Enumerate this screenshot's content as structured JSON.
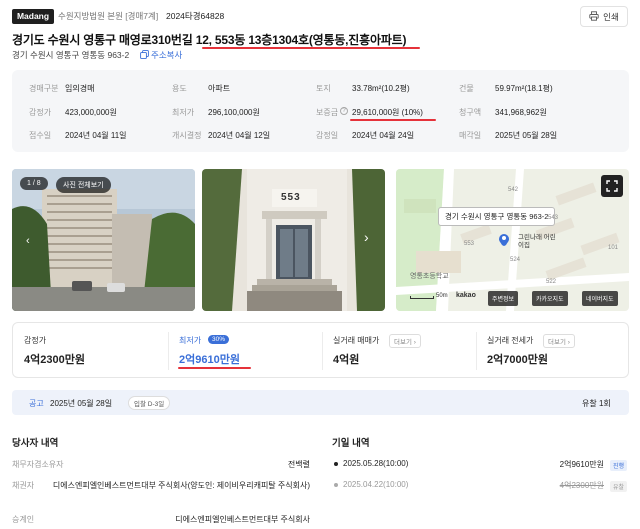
{
  "header": {
    "logo": "Madang",
    "court": "수원지방법원 본원 [경매7계]",
    "case_no": "2024타경64828",
    "print_label": "인쇄"
  },
  "title": {
    "address": "경기도 수원시 영통구 매영로310번길 12, 553동 13층1304호(영통동,진흥아파트)",
    "lot_address": "경기 수원시 영통구 영통동 963-2",
    "copy_label": "주소복사"
  },
  "info": {
    "rows": [
      [
        {
          "label": "경매구분",
          "value": "임의경매"
        },
        {
          "label": "용도",
          "value": "아파트"
        },
        {
          "label": "토지",
          "value": "33.78m²(10.2평)"
        },
        {
          "label": "건물",
          "value": "59.97m²(18.1평)"
        }
      ],
      [
        {
          "label": "감정가",
          "value": "423,000,000원"
        },
        {
          "label": "최저가",
          "value": "296,100,000원"
        },
        {
          "label": "보증금",
          "value": "29,610,000원 (10%)"
        },
        {
          "label": "청구액",
          "value": "341,968,962원"
        }
      ],
      [
        {
          "label": "접수일",
          "value": "2024년 04월 11일"
        },
        {
          "label": "개시결정",
          "value": "2024년 04월 12일"
        },
        {
          "label": "감정일",
          "value": "2024년 04월 24일"
        },
        {
          "label": "매각일",
          "value": "2025년 05월 28일"
        }
      ]
    ]
  },
  "photos": {
    "counter": "1 / 8",
    "view_all": "사진 전체보기",
    "building_sign": "553"
  },
  "map": {
    "popup": "경기 수원시 영통구 영통동 963-2",
    "school": "영통초등학교",
    "kindergarten": "그린나래 어린이집",
    "scale": "50m",
    "brand": "kakao",
    "numbers": [
      "542",
      "543",
      "553",
      "524",
      "522",
      "101"
    ],
    "buttons": [
      "주변정보",
      "카카오지도",
      "네이버지도"
    ]
  },
  "prices": {
    "appraisal_label": "감정가",
    "appraisal_value": "4억2300만원",
    "min_label": "최저가",
    "min_pct": "30%",
    "min_value": "2억9610만원",
    "sale_label": "실거래 매매가",
    "sale_value": "4억원",
    "jeonse_label": "실거래 전세가",
    "jeonse_value": "2억7000만원",
    "more_label": "더보기"
  },
  "notice": {
    "label": "공고",
    "date": "2025년 05월 28일",
    "badge": "입찰 D-3일",
    "fail": "유찰 1회"
  },
  "parties": {
    "title": "당사자 내역",
    "rows": [
      {
        "label": "채무자겸소유자",
        "value": "전백렬"
      },
      {
        "label": "채권자",
        "value": "디에스엔피엘인베스트먼트대부 주식회사(양도인: 제이비우리캐피탈 주식회사)"
      },
      {
        "label": "승계인",
        "value": "디에스엔피엘인베스트먼트대부 주식회사"
      }
    ]
  },
  "dates": {
    "title": "기일 내역",
    "rows": [
      {
        "date": "2025.05.28(10:00)",
        "price": "2억9610만원",
        "status": "진행",
        "status_color": "#3a6fd8"
      },
      {
        "date": "2025.04.22(10:00)",
        "price": "4억2300만원",
        "status": "유찰",
        "status_color": "#999999"
      }
    ]
  },
  "colors": {
    "accent": "#3a6fd8",
    "highlight": "#e5323a"
  }
}
